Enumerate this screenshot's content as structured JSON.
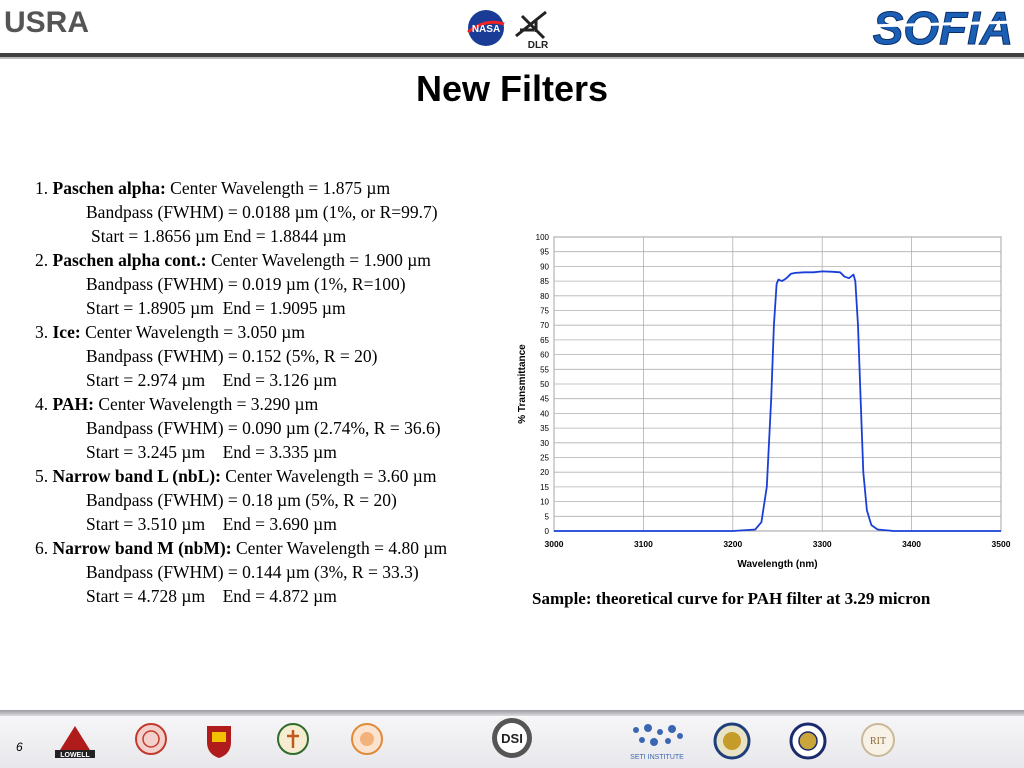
{
  "header": {
    "usra_logo": "USRA",
    "dlr_logo": "DLR",
    "nasa_logo": "NASA",
    "sofia_logo": "SOFIA"
  },
  "title": "New Filters",
  "filters": [
    {
      "num": "1.",
      "name": "Paschen alpha:",
      "center": "Center Wavelength = 1.875 µm",
      "bandpass": "Bandpass (FWHM) = 0.0188 µm (1%, or R=99.7)",
      "range": "Start = 1.8656 µm End = 1.8844 µm"
    },
    {
      "num": "2.",
      "name": "Paschen alpha cont.:",
      "center": "Center Wavelength = 1.900 µm",
      "bandpass": "Bandpass (FWHM) = 0.019 µm (1%, R=100)",
      "range": "Start = 1.8905 µm  End = 1.9095 µm"
    },
    {
      "num": "3.",
      "name": "Ice:",
      "center": "Center Wavelength = 3.050 µm",
      "bandpass": "Bandpass (FWHM) = 0.152 (5%, R = 20)",
      "range": "Start = 2.974 µm    End = 3.126 µm"
    },
    {
      "num": "4.",
      "name": "PAH:",
      "center": "Center Wavelength = 3.290 µm",
      "bandpass": "Bandpass (FWHM) = 0.090 µm (2.74%, R = 36.6)",
      "range": "Start = 3.245 µm    End = 3.335 µm"
    },
    {
      "num": "5.",
      "name": "Narrow band L (nbL):",
      "center": "Center Wavelength = 3.60 µm",
      "bandpass": "Bandpass (FWHM) = 0.18 µm (5%, R = 20)",
      "range": "Start = 3.510 µm    End = 3.690 µm"
    },
    {
      "num": "6.",
      "name": "Narrow band M (nbM):",
      "center": "Center Wavelength = 4.80 µm",
      "bandpass": "Bandpass (FWHM) = 0.144 µm (3%, R = 33.3)",
      "range": "Start = 4.728 µm    End = 4.872 µm"
    }
  ],
  "chart_data": {
    "type": "line",
    "title": "",
    "xlabel": "Wavelength (nm)",
    "ylabel": "% Transmittance",
    "xlim": [
      3000,
      3500
    ],
    "ylim": [
      0,
      100
    ],
    "xticks": [
      3000,
      3100,
      3200,
      3300,
      3400,
      3500
    ],
    "yticks": [
      0,
      5,
      10,
      15,
      20,
      25,
      30,
      35,
      40,
      45,
      50,
      55,
      60,
      65,
      70,
      75,
      80,
      85,
      90,
      95,
      100
    ],
    "grid": true,
    "series": [
      {
        "color": "#1a3fd6",
        "x": [
          3000,
          3200,
          3225,
          3232,
          3238,
          3243,
          3246,
          3249,
          3251,
          3255,
          3260,
          3265,
          3270,
          3280,
          3290,
          3300,
          3310,
          3320,
          3325,
          3330,
          3335,
          3337,
          3340,
          3343,
          3346,
          3350,
          3355,
          3362,
          3380,
          3500
        ],
        "y": [
          0,
          0,
          0.5,
          3,
          15,
          45,
          70,
          84,
          85.5,
          85,
          86,
          87.5,
          87.8,
          88,
          88,
          88.3,
          88.2,
          88,
          86.5,
          86,
          87.2,
          85,
          70,
          45,
          20,
          7,
          2,
          0.5,
          0,
          0
        ]
      }
    ]
  },
  "caption": "Sample: theoretical curve for PAH filter at 3.29 micron",
  "footer": {
    "page_number": "6",
    "logos": [
      "LOWELL",
      "DSI",
      "SETI INSTITUTE",
      "RIT"
    ]
  }
}
